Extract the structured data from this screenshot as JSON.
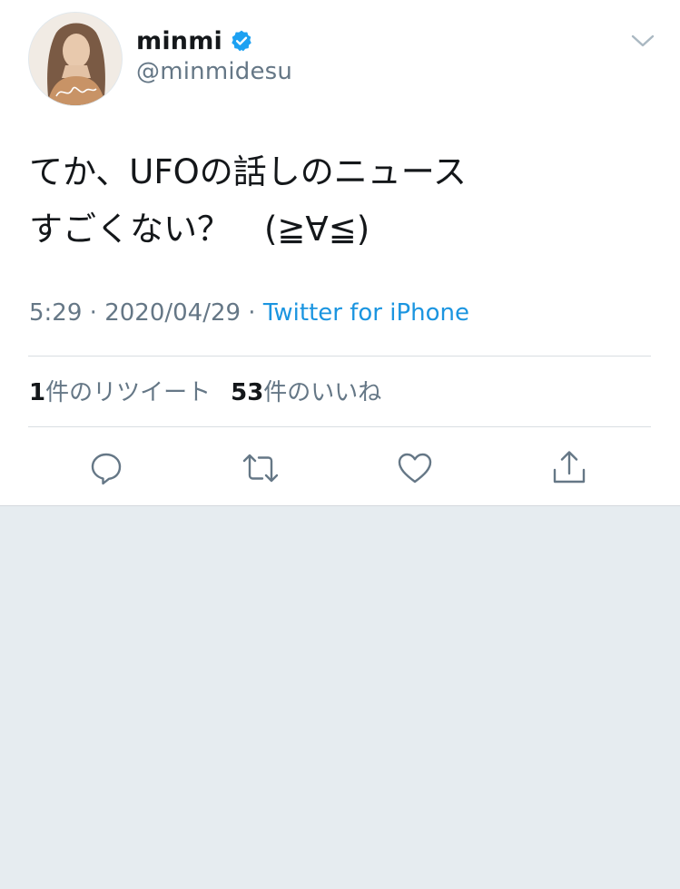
{
  "user": {
    "display_name": "minmi",
    "handle": "@minmidesu",
    "verified": true
  },
  "tweet": {
    "text_line1": "てか、UFOの話しのニュース",
    "text_line2": "すごくない？　(≧∀≦)",
    "time": "5:29",
    "date": "2020/04/29",
    "separator": " · ",
    "source": "Twitter for iPhone"
  },
  "stats": {
    "retweets_count": "1",
    "retweets_label": "件のリツイート",
    "likes_count": "53",
    "likes_label": "件のいいね"
  },
  "icons": {
    "menu": "chevron-down-icon",
    "reply": "reply-icon",
    "retweet": "retweet-icon",
    "like": "heart-icon",
    "share": "share-icon",
    "verified": "verified-badge-icon"
  },
  "colors": {
    "accent": "#1b95e0",
    "verified": "#1da1f2",
    "secondary_text": "#657786",
    "icon_gray": "#657786",
    "background": "#e6ecf0"
  }
}
